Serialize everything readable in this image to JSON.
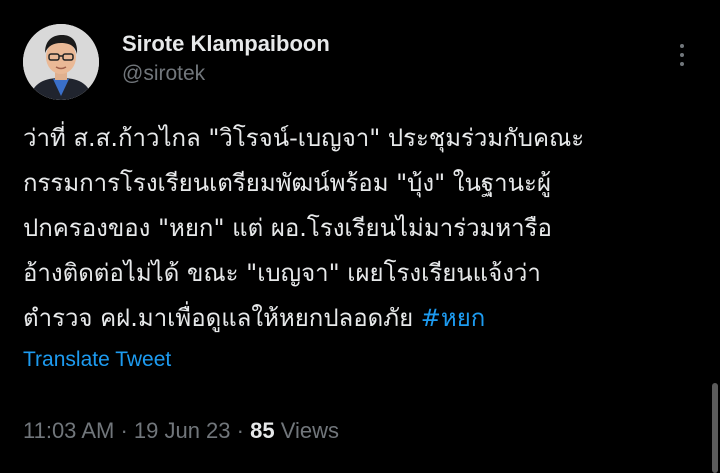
{
  "author": {
    "display_name": "Sirote Klampaiboon",
    "handle": "@sirotek"
  },
  "menu_icon": "more-horizontal-icon",
  "tweet": {
    "lines": [
      "ว่าที่ ส.ส.ก้าวไกล \"วิโรจน์-เบญจา\" ประชุมร่วมกับคณะ",
      "กรรมการโรงเรียนเตรียมพัฒน์พร้อม \"บุ้ง\" ในฐานะผู้",
      "ปกครองของ \"หยก\" แต่ ผอ.โรงเรียนไม่มาร่วมหารือ",
      "อ้างติดต่อไม่ได้ ขณะ \"เบญจา\" เผยโรงเรียนแจ้งว่า",
      "ตำรวจ คฝ.มาเพื่อดูแลให้หยกปลอดภัย "
    ],
    "hashtag": "#หยก"
  },
  "translate_label": "Translate Tweet",
  "meta": {
    "time": "11:03 AM",
    "separator": " · ",
    "date": "19 Jun 23",
    "views_count": "85",
    "views_label": " Views"
  },
  "colors": {
    "background": "#000000",
    "text": "#e7e9ea",
    "secondary": "#71767b",
    "accent": "#1d9bf0"
  }
}
